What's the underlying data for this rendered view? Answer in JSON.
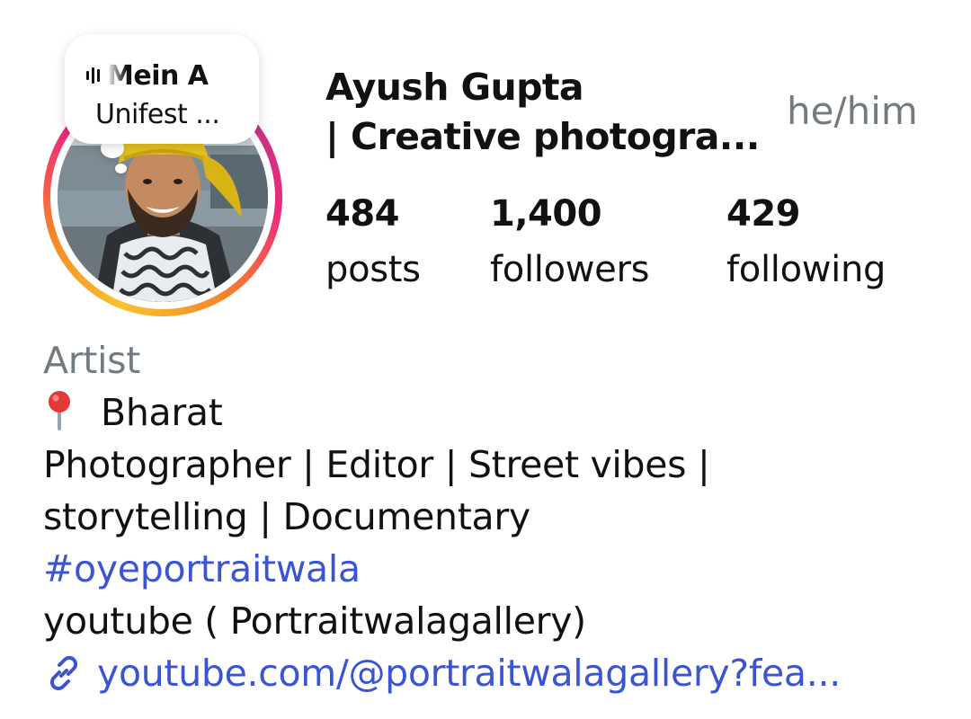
{
  "note": {
    "song": "Mein A",
    "artist": "Unifest ..."
  },
  "profile": {
    "name_line1": "Ayush Gupta",
    "name_line2": "| Creative photogra...",
    "pronouns": "he/him"
  },
  "stats": {
    "posts_count": "484",
    "posts_label": "posts",
    "followers_count": "1,400",
    "followers_label": "followers",
    "following_count": "429",
    "following_label": "following"
  },
  "bio": {
    "category": "Artist",
    "location": "Bharat",
    "line1": "Photographer | Editor | Street vibes |",
    "line2": "storytelling | Documentary",
    "hashtag": "#oyeportraitwala",
    "line3": "youtube ( Portraitwalagallery)",
    "link": "youtube.com/@portraitwalagallery?fea..."
  },
  "icons": {
    "note_music": "music-bars-icon",
    "location": "location-pin-icon",
    "link": "link-icon"
  },
  "colors": {
    "link_blue": "#3b54d4",
    "muted_gray": "#737b82",
    "ring_gradient": [
      "#f9c22e",
      "#f58529",
      "#ee2a7b",
      "#c13584"
    ]
  }
}
